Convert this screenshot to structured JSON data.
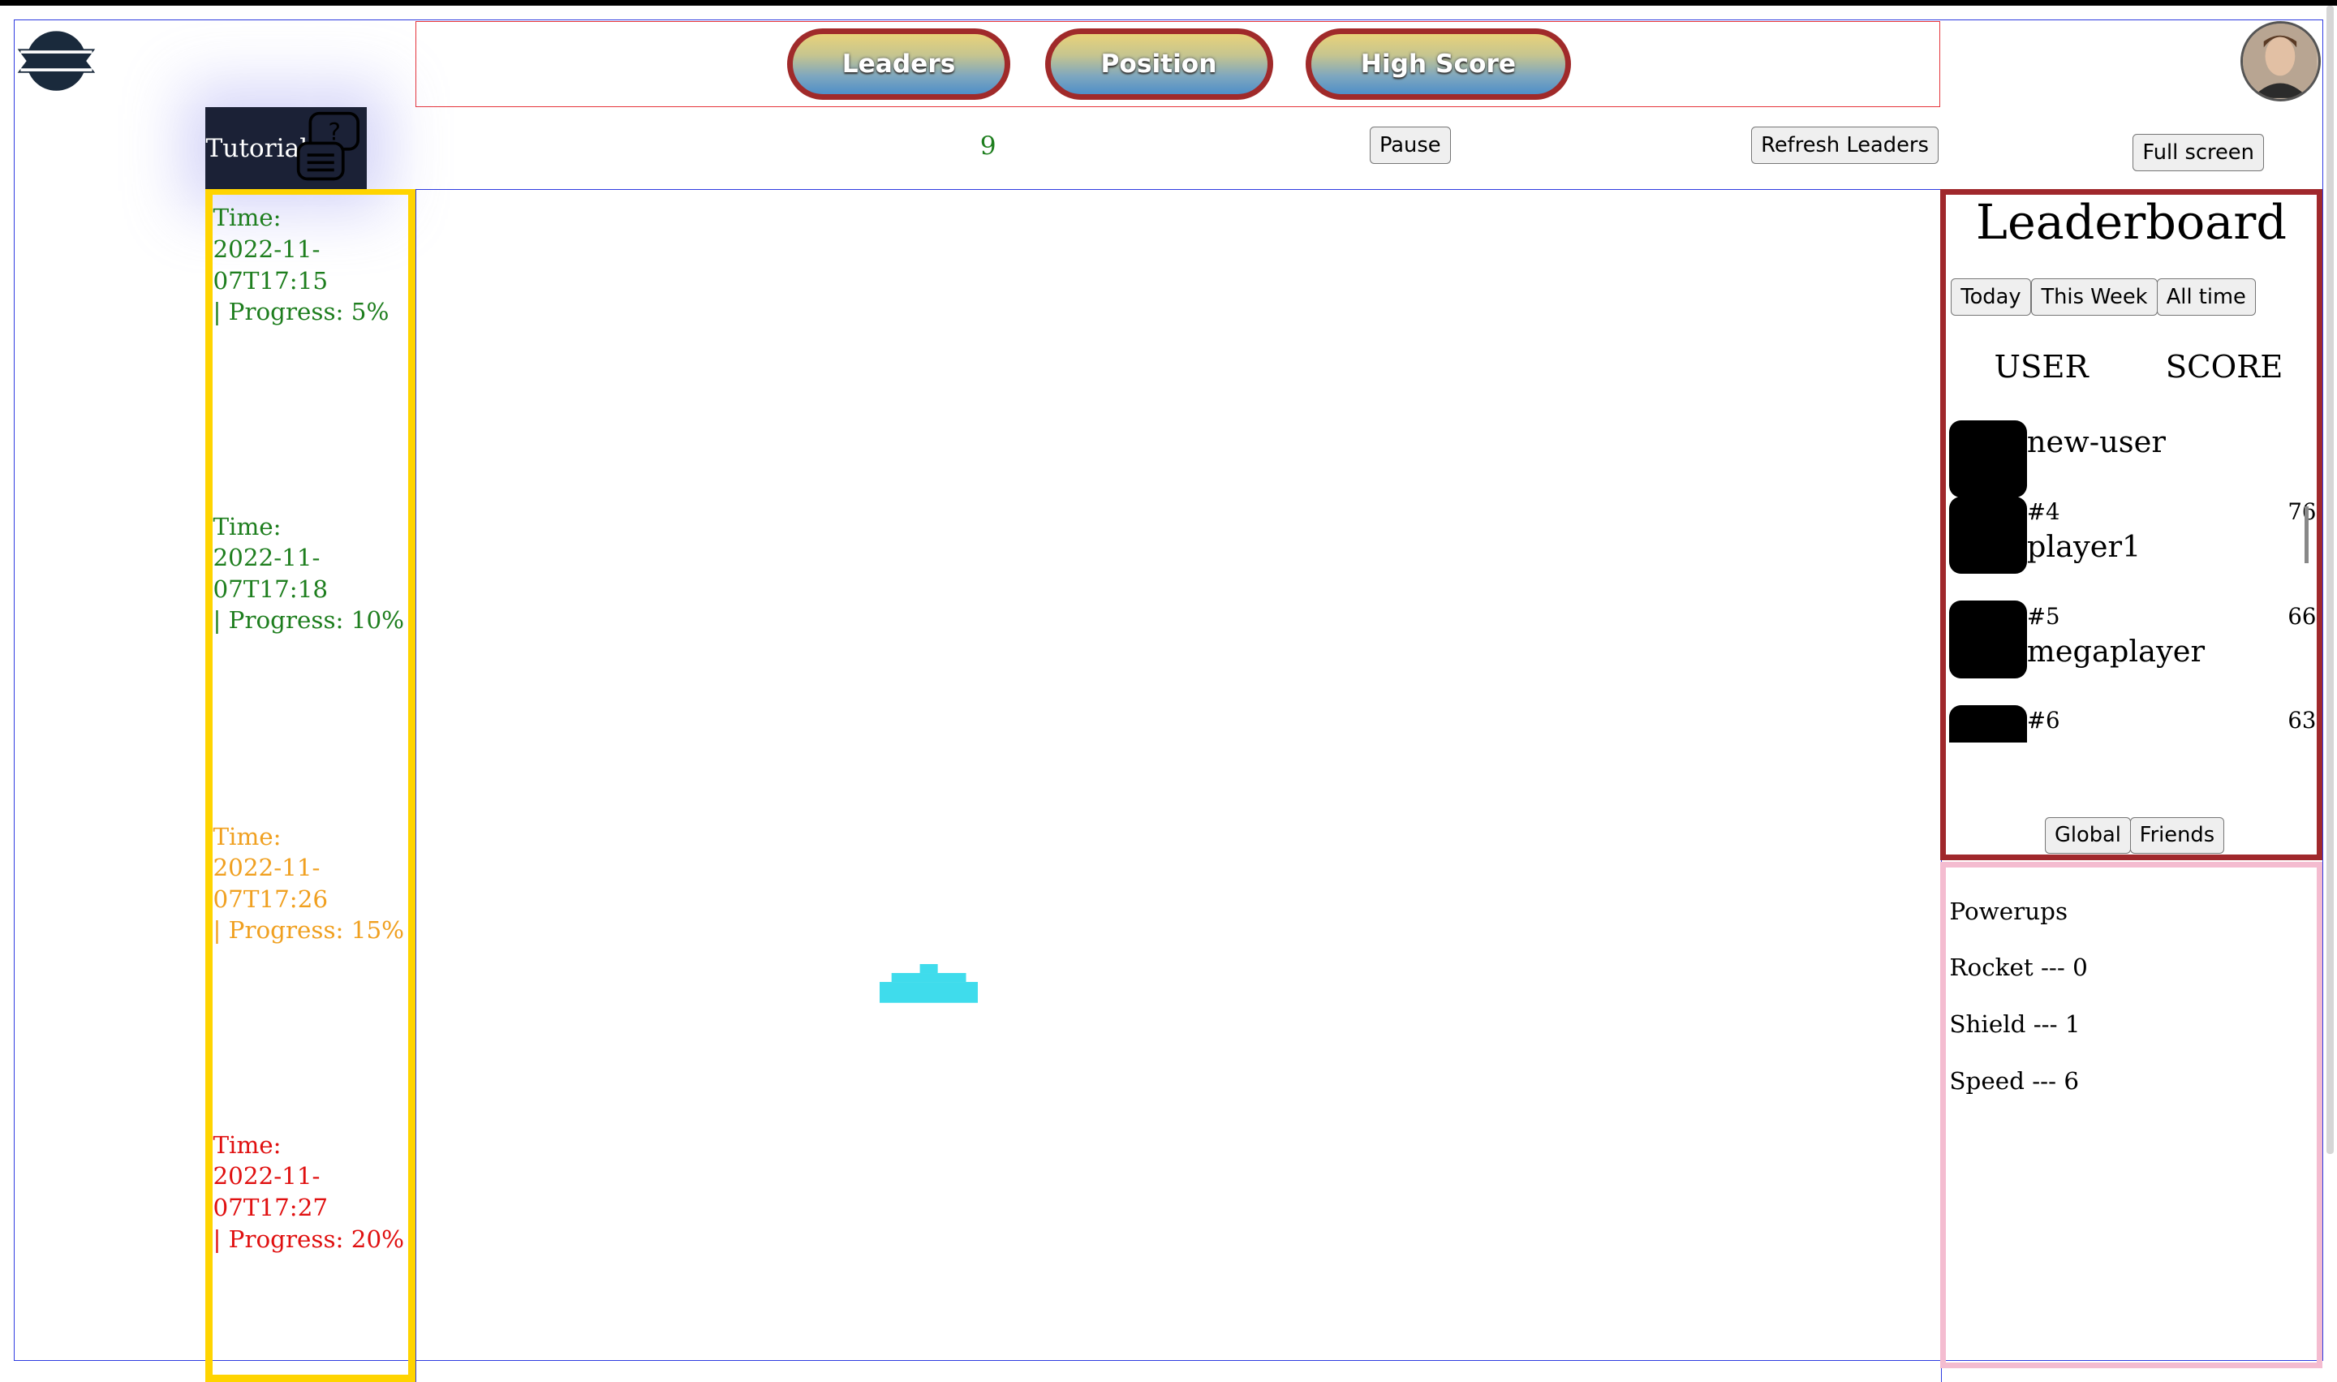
{
  "nav": {
    "tabs": [
      {
        "label": "Leaders"
      },
      {
        "label": "Position"
      },
      {
        "label": "High Score"
      }
    ]
  },
  "toolbar": {
    "tutorial_label": "Tutorial",
    "score": "9",
    "pause_label": "Pause",
    "refresh_label": "Refresh Leaders",
    "fullscreen_label": "Full screen"
  },
  "progress_log": [
    {
      "time_label": "Time:",
      "time": "2022-11-07T17:15",
      "progress": "| Progress: 5%",
      "color": "#1e7e1e"
    },
    {
      "time_label": "Time:",
      "time": "2022-11-07T17:18",
      "progress": "| Progress: 10%",
      "color": "#1e7e1e"
    },
    {
      "time_label": "Time:",
      "time": "2022-11-07T17:26",
      "progress": "| Progress: 15%",
      "color": "#f0a020"
    },
    {
      "time_label": "Time:",
      "time": "2022-11-07T17:27",
      "progress": "| Progress: 20%",
      "color": "#e01010"
    }
  ],
  "leaderboard": {
    "title": "Leaderboard",
    "filters": [
      "Today",
      "This Week",
      "All time"
    ],
    "col_user": "USER",
    "col_score": "SCORE",
    "rows": [
      {
        "rank": "",
        "name": "new-user",
        "score": ""
      },
      {
        "rank": "#4",
        "name": "player1",
        "score": "76"
      },
      {
        "rank": "#5",
        "name": "megaplayer",
        "score": "66"
      },
      {
        "rank": "#6",
        "name": "",
        "score": "63"
      }
    ],
    "scope_global": "Global",
    "scope_friends": "Friends"
  },
  "powerups": {
    "title": "Powerups",
    "rocket": "Rocket --- 0",
    "shield": "Shield --- 1",
    "speed": "Speed --- 6"
  },
  "colors": {
    "frame_blue": "#2e3be0",
    "tab_border": "#a02a2a",
    "sidebar_yellow": "#ffd400",
    "leader_border": "#a0282c",
    "powerups_border": "#f4bcd0",
    "ship_cyan": "#3fdcec"
  },
  "icons": {
    "logo": "logo-emblem-icon",
    "tutorial": "help-chat-icon",
    "ship": "spaceship-icon",
    "avatar": "user-avatar"
  }
}
